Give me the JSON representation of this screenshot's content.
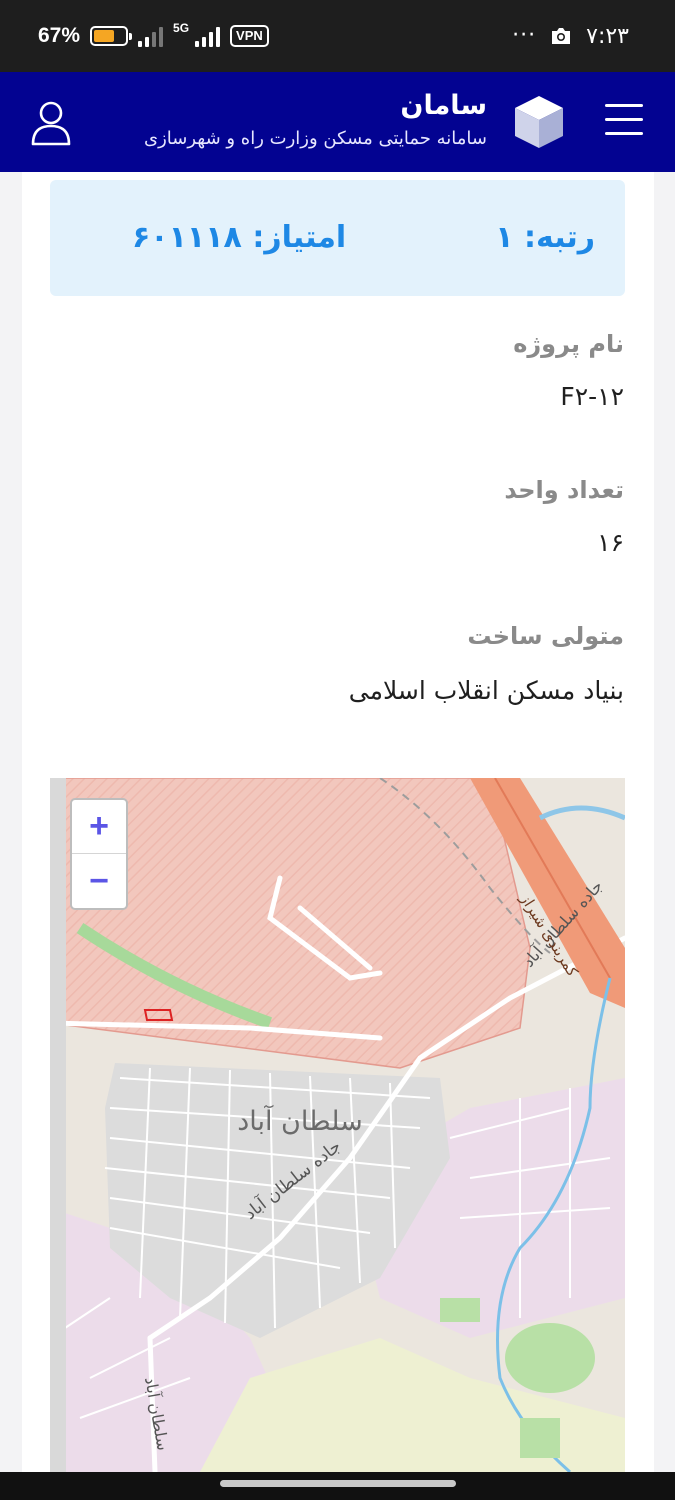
{
  "status_bar": {
    "battery": "67%",
    "battery_level": 0.67,
    "network": "5G",
    "vpn": "VPN",
    "time": "۷:۲۳",
    "overflow": "···",
    "icons": [
      "battery-icon",
      "signal-icon",
      "vpn-icon",
      "camera-icon"
    ]
  },
  "app_bar": {
    "title": "سامان",
    "subtitle": "سامانه حمایتی مسکن وزارت راه و شهرسازی",
    "icons": [
      "menu-icon",
      "cube-logo-icon",
      "user-icon"
    ],
    "color": "#030391"
  },
  "score": {
    "rank": "رتبه: ۱",
    "points": "امتیاز: ۶۰۱۱۱۸",
    "color": "#1e88e5",
    "background": "#e3f2fc"
  },
  "fields": [
    {
      "label": "نام پروژه",
      "value": "F۲-۱۲"
    },
    {
      "label": "تعداد واحد",
      "value": "۱۶"
    },
    {
      "label": "متولی ساخت",
      "value": "بنیاد مسکن انقلاب اسلامی"
    }
  ],
  "map": {
    "zoom_in": "+",
    "zoom_out": "−",
    "labels": {
      "city": "سلطان آباد",
      "road_main": "جاده سلطان آباد",
      "road_main_2": "جاده سلطان آباد",
      "road_south": "سلطان آباد",
      "ring_road": "کمربندی شیراز"
    }
  }
}
